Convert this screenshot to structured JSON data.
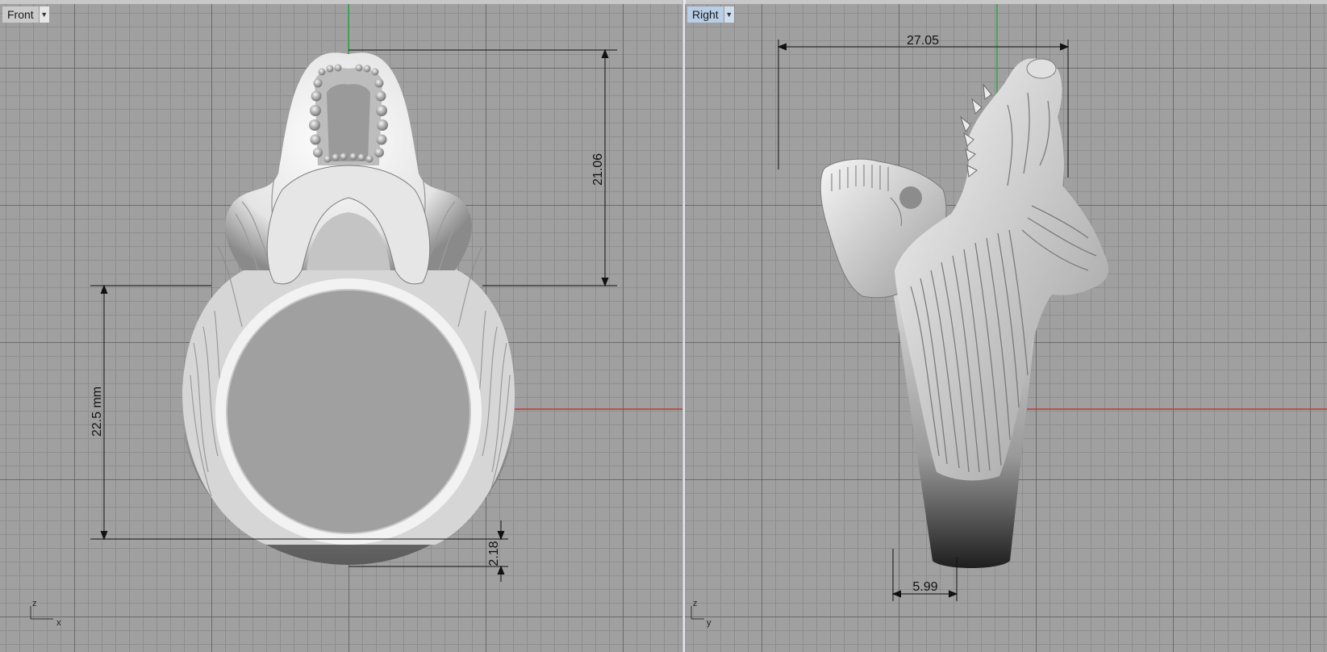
{
  "viewports": {
    "front": {
      "label": "Front",
      "dimensions": {
        "top_height": "21.06",
        "inner_diameter": "22.5 mm",
        "shank_thickness": "2.18"
      },
      "axes": {
        "vertical": "z",
        "horizontal": "x"
      }
    },
    "right": {
      "label": "Right",
      "dimensions": {
        "top_width": "27.05",
        "shank_width": "5.99"
      },
      "axes": {
        "vertical": "z",
        "horizontal": "y"
      }
    }
  },
  "colors": {
    "x_axis": "#c0392b",
    "y_axis": "#2fa84a",
    "grid_major": "#4e4e4e",
    "grid_minor": "#8e8e8e",
    "background": "#a0a0a0"
  }
}
